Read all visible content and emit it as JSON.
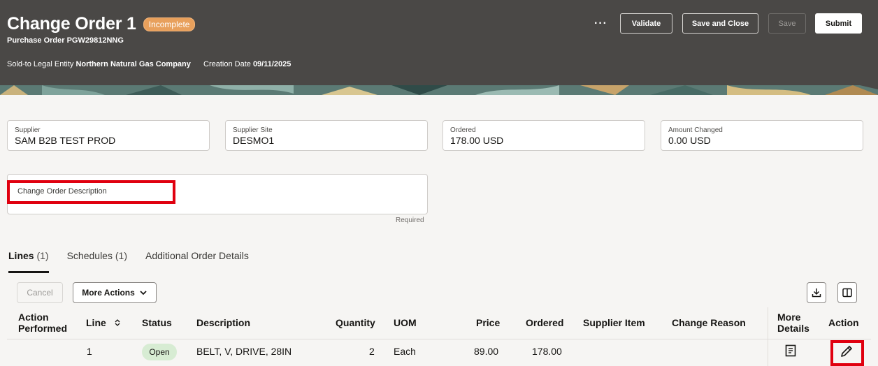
{
  "header": {
    "title": "Change Order 1",
    "status_badge": "Incomplete",
    "subtitle": "Purchase Order PGW29812NNG",
    "legal_entity_label": "Sold-to Legal Entity",
    "legal_entity_value": "Northern Natural Gas Company",
    "creation_date_label": "Creation Date",
    "creation_date_value": "09/11/2025",
    "more_label": "···",
    "buttons": {
      "validate": "Validate",
      "save_and_close": "Save and Close",
      "save": "Save",
      "submit": "Submit"
    }
  },
  "fields": {
    "supplier": {
      "label": "Supplier",
      "value": "SAM B2B TEST PROD"
    },
    "supplier_site": {
      "label": "Supplier Site",
      "value": "DESMO1"
    },
    "ordered": {
      "label": "Ordered",
      "value": "178.00 USD"
    },
    "amount_changed": {
      "label": "Amount Changed",
      "value": "0.00 USD"
    },
    "description": {
      "label": "Change Order Description",
      "required": "Required"
    }
  },
  "tabs": [
    {
      "label": "Lines",
      "count": "(1)"
    },
    {
      "label": "Schedules",
      "count": "(1)"
    },
    {
      "label": "Additional Order Details",
      "count": ""
    }
  ],
  "toolbar": {
    "cancel": "Cancel",
    "more_actions": "More Actions"
  },
  "table": {
    "headers": {
      "action_performed_1": "Action",
      "action_performed_2": "Performed",
      "line": "Line",
      "status": "Status",
      "description": "Description",
      "quantity": "Quantity",
      "uom": "UOM",
      "price": "Price",
      "ordered": "Ordered",
      "supplier_item": "Supplier Item",
      "change_reason": "Change Reason",
      "more_details_1": "More",
      "more_details_2": "Details",
      "action": "Action"
    },
    "rows": [
      {
        "line": "1",
        "status": "Open",
        "description": "BELT, V, DRIVE, 28IN",
        "quantity": "2",
        "uom": "Each",
        "price": "89.00",
        "ordered": "178.00"
      }
    ]
  },
  "colors": {
    "header_bg": "#4a4846",
    "badge": "#e8a05c",
    "status_open": "#d7ecd3",
    "highlight": "#e0000f"
  }
}
